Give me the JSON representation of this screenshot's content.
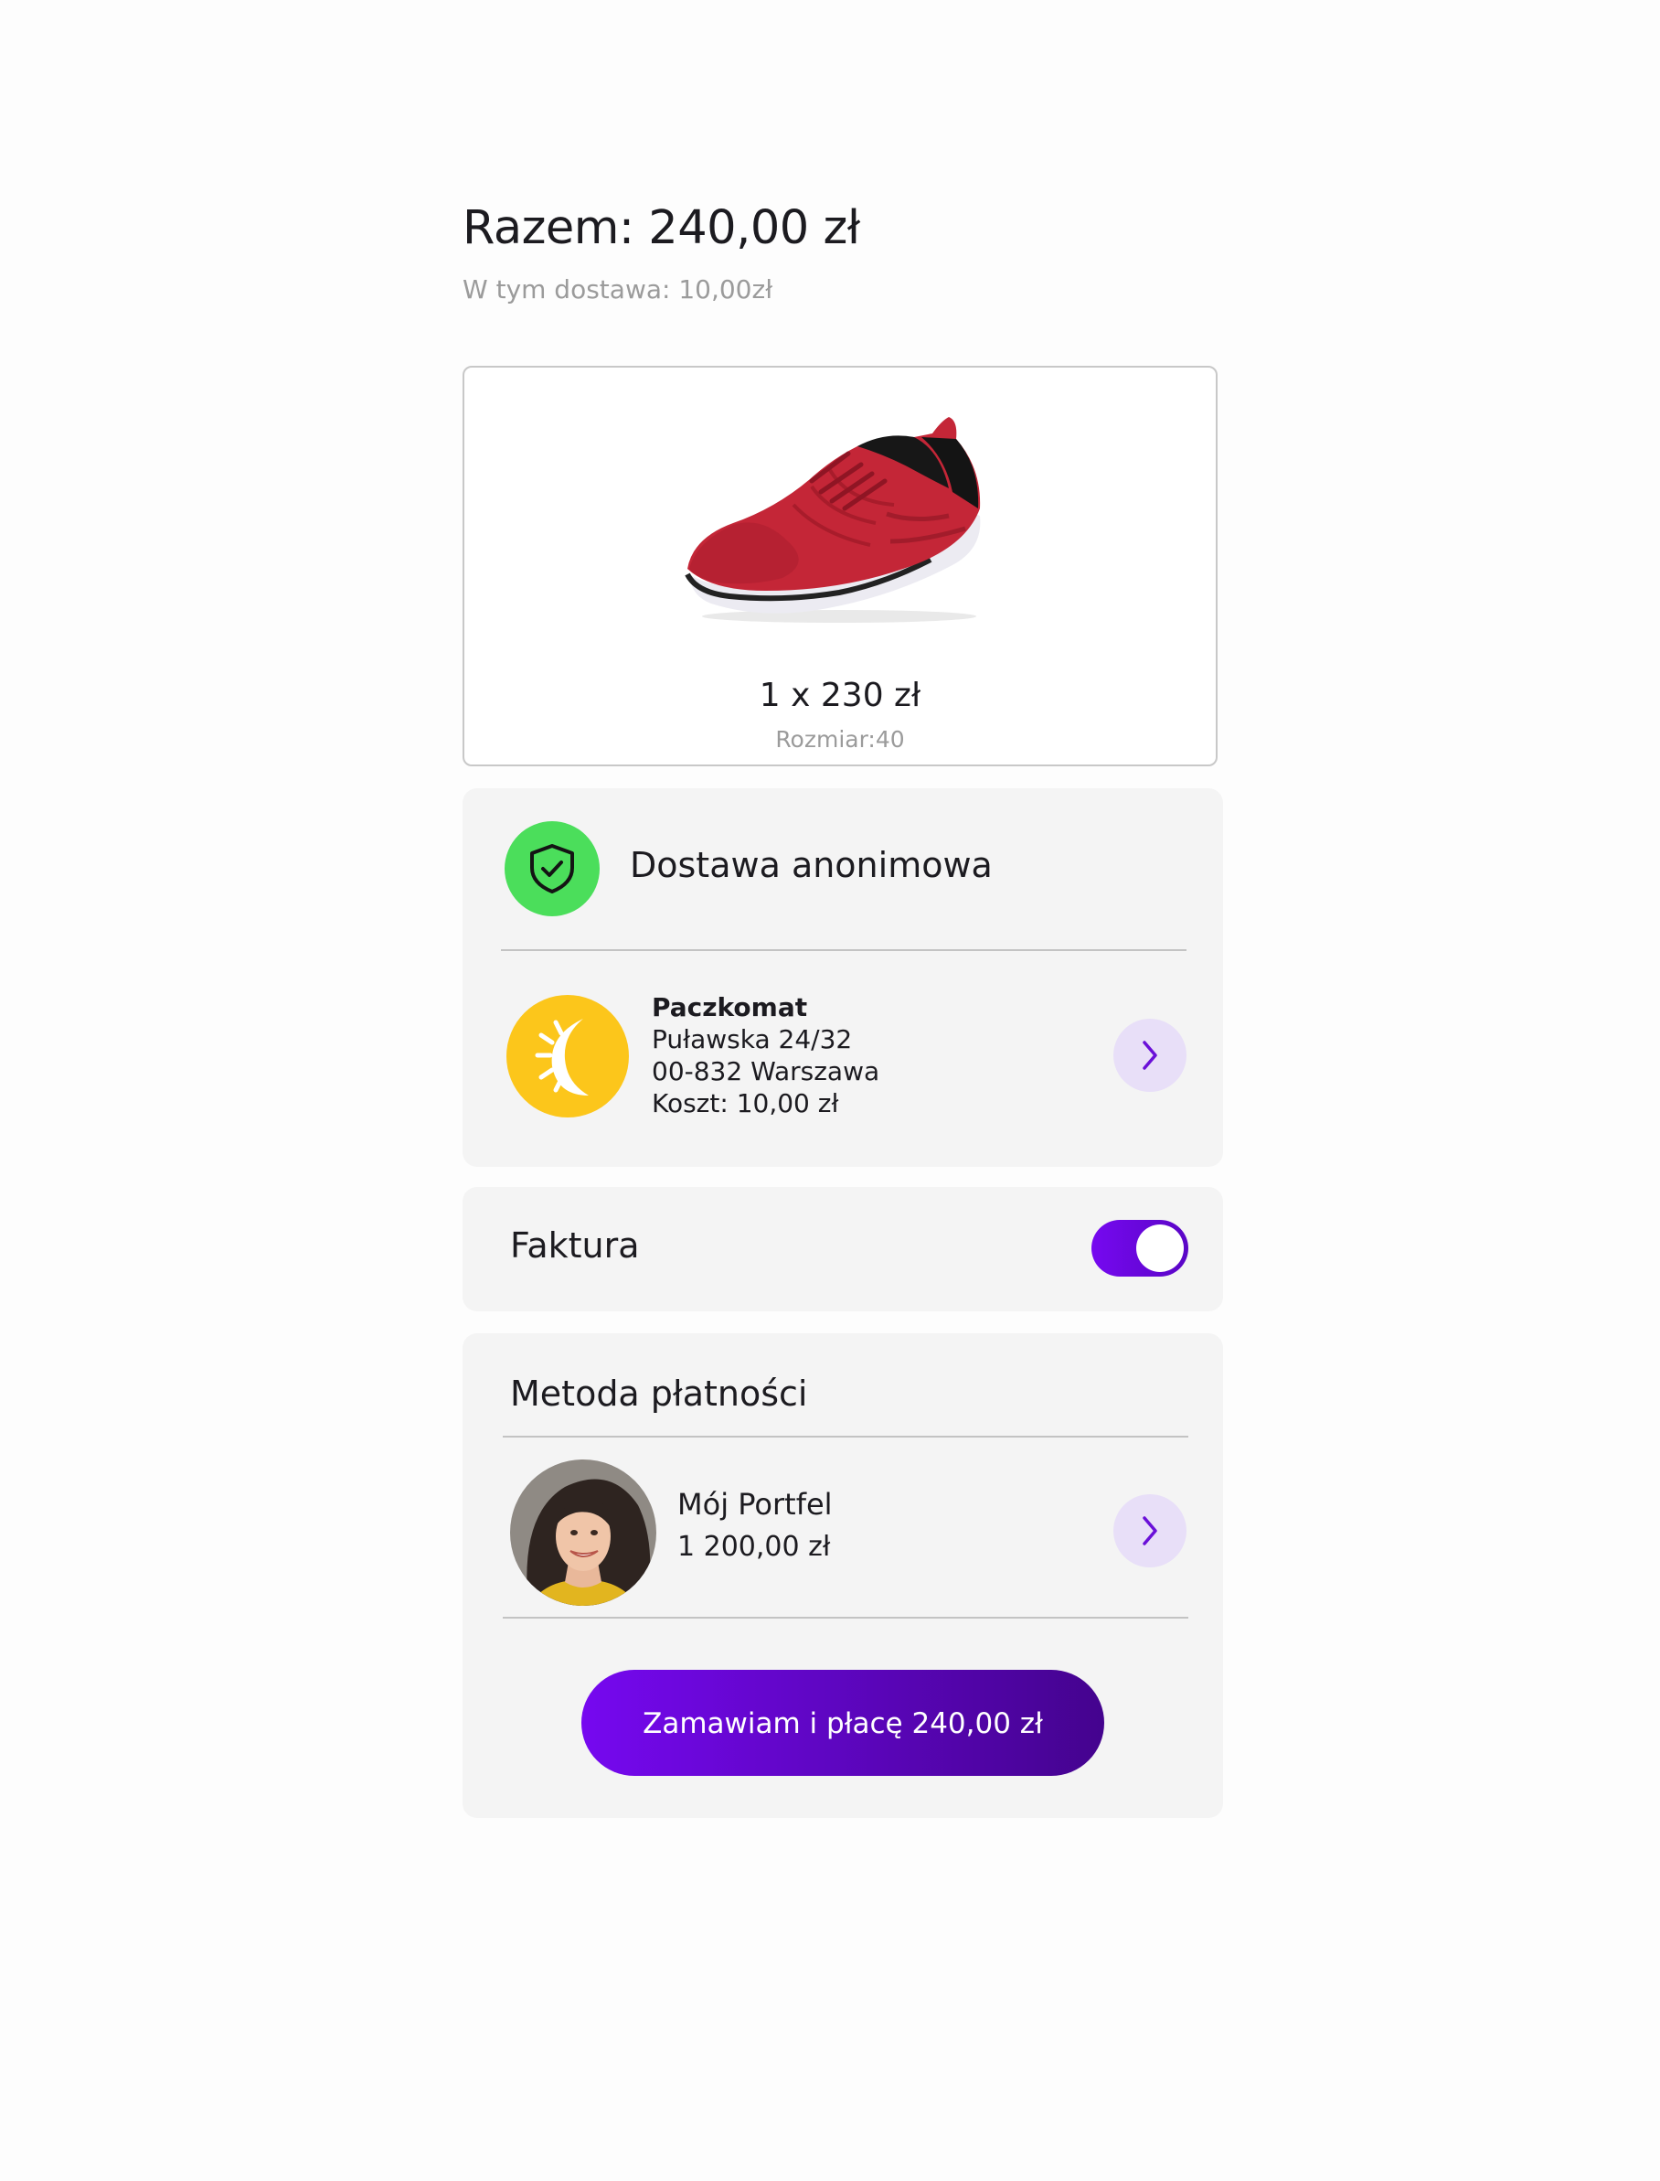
{
  "summary": {
    "total": "Razem: 240,00 zł",
    "delivery_included": "W tym dostawa: 10,00zł"
  },
  "product": {
    "image_icon": "red-sneaker-image",
    "quantity_price": "1 x 230 zł",
    "size": "Rozmiar:40"
  },
  "delivery": {
    "anonymous_label": "Dostawa anonimowa",
    "anonymous_icon": "shield-check-icon",
    "anonymous_icon_color": "#4bde5b",
    "locker": {
      "icon": "sun-logo-icon",
      "icon_color": "#fcc61b",
      "name": "Paczkomat",
      "street": "Puławska 24/32",
      "city": "00-832 Warszawa",
      "cost": "Koszt: 10,00 zł"
    }
  },
  "invoice": {
    "label": "Faktura",
    "enabled": true
  },
  "payment": {
    "title": "Metoda płatności",
    "wallet_name": "Mój Portfel",
    "wallet_balance": "1 200,00 zł",
    "submit_label": "Zamawiam i płacę 240,00 zł"
  },
  "colors": {
    "accent": "#7608f0",
    "accent_dark": "#44038e",
    "chevron_bg": "#e8dff8",
    "panel_bg": "#f4f4f4"
  }
}
